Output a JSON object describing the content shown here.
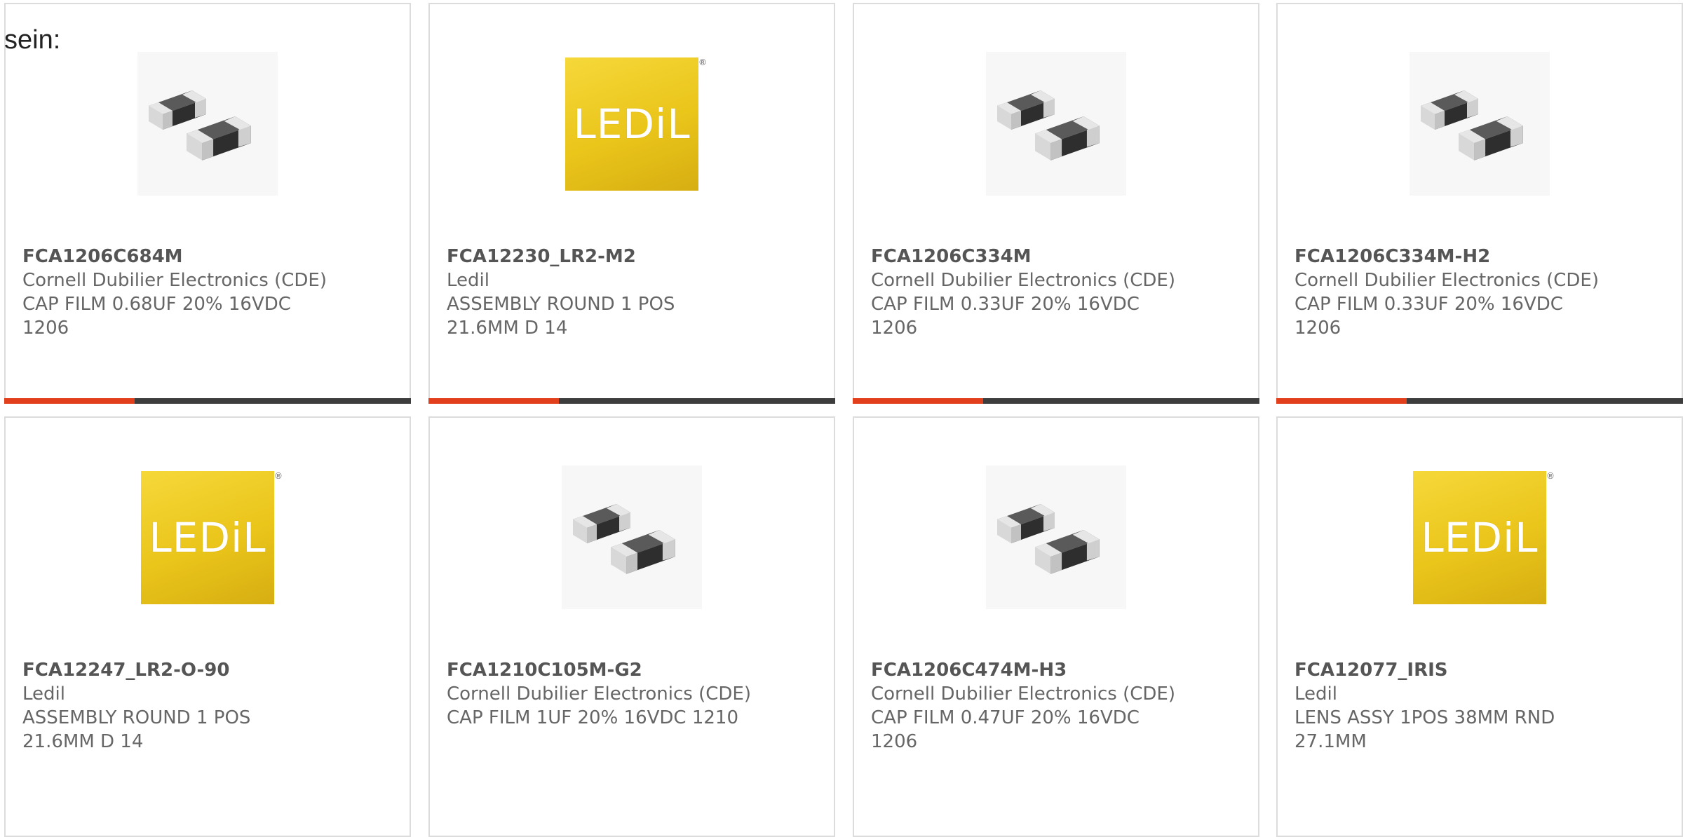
{
  "intro_text": "sein:",
  "colors": {
    "accent": "#e2401c",
    "bar": "#3d3d3d",
    "border": "#dcdcdc",
    "ledil_yellow": "#f0cc1e"
  },
  "products": [
    {
      "part_number": "FCA1206C684M",
      "manufacturer": "Cornell Dubilier Electronics (CDE)",
      "desc1": "CAP FILM 0.68UF 20% 16VDC",
      "desc2": "1206",
      "image": "smd-capacitor-image",
      "progress": 0.32
    },
    {
      "part_number": "FCA12230_LR2-M2",
      "manufacturer": "Ledil",
      "desc1": "ASSEMBLY ROUND 1 POS",
      "desc2": "21.6MM D 14",
      "image": "ledil-logo",
      "logo_text": "LEDiL",
      "progress": 0.32
    },
    {
      "part_number": "FCA1206C334M",
      "manufacturer": "Cornell Dubilier Electronics (CDE)",
      "desc1": "CAP FILM 0.33UF 20% 16VDC",
      "desc2": "1206",
      "image": "smd-capacitor-image",
      "progress": 0.32
    },
    {
      "part_number": "FCA1206C334M-H2",
      "manufacturer": "Cornell Dubilier Electronics (CDE)",
      "desc1": "CAP FILM 0.33UF 20% 16VDC",
      "desc2": "1206",
      "image": "smd-capacitor-image",
      "progress": 0.32
    },
    {
      "part_number": "FCA12247_LR2-O-90",
      "manufacturer": "Ledil",
      "desc1": "ASSEMBLY ROUND 1 POS",
      "desc2": "21.6MM D 14",
      "image": "ledil-logo",
      "logo_text": "LEDiL"
    },
    {
      "part_number": "FCA1210C105M-G2",
      "manufacturer": "Cornell Dubilier Electronics (CDE)",
      "desc1": "CAP FILM 1UF 20% 16VDC 1210",
      "desc2": "",
      "image": "smd-capacitor-image"
    },
    {
      "part_number": "FCA1206C474M-H3",
      "manufacturer": "Cornell Dubilier Electronics (CDE)",
      "desc1": "CAP FILM 0.47UF 20% 16VDC",
      "desc2": "1206",
      "image": "smd-capacitor-image"
    },
    {
      "part_number": "FCA12077_IRIS",
      "manufacturer": "Ledil",
      "desc1": "LENS ASSY 1POS 38MM RND",
      "desc2": "27.1MM",
      "image": "ledil-logo",
      "logo_text": "LEDiL"
    }
  ]
}
